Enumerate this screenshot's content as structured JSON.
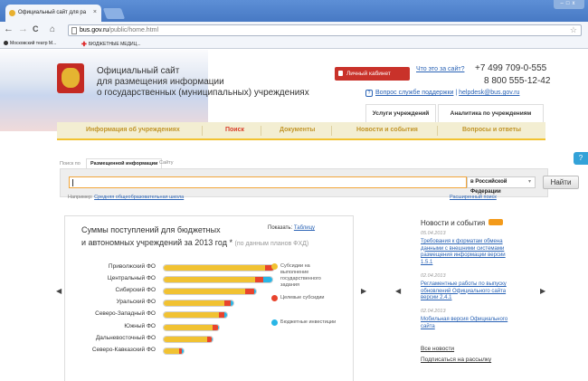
{
  "browser": {
    "tab_title": "Официальный сайт для ра",
    "tab_close": "×",
    "url_domain": "bus.gov.ru",
    "url_path": "/public/home.html",
    "nav": {
      "back": "←",
      "forward": "→",
      "reload": "C",
      "home": "⌂"
    },
    "star": "☆",
    "bookmarks": [
      "Московский театр М...",
      "БЮДЖЕТНЫЕ МЕДИЦ..."
    ],
    "window_buttons": "–□x"
  },
  "header": {
    "site_title_lines": [
      "Официальный сайт",
      "для размещения информации",
      "о государственных (муниципальных) учреждениях"
    ],
    "cabinet_button": "Личный кабинет",
    "what_link": "Что это за сайт?",
    "phone1": "+7 499 709-0-555",
    "phone2": "8 800 555-12-42",
    "support_link": "Вопрос службе поддержки",
    "support_sep": " | ",
    "support_email": "helpdesk@bus.gov.ru",
    "support_icon": "?",
    "subtabs": [
      "Услуги учреждений",
      "Аналитика по учреждениям"
    ]
  },
  "main_nav": {
    "items": [
      "Информация об учреждениях",
      "Поиск",
      "Документы",
      "Новости и события",
      "Вопросы и ответы"
    ],
    "active_index": 1
  },
  "help_button": "?",
  "search": {
    "prefix_label": "Поиск по",
    "tabs": [
      "Размещенной информации",
      "Сайту"
    ],
    "query_value": "",
    "scope_value": "в Российской Федерации",
    "scope_caret": "▾",
    "go_button": "Найти",
    "hint_prefix": "Например:",
    "hint_example": "Средняя общеобразовательная школа",
    "advanced_link": "Расширенный поиск"
  },
  "chart_panel": {
    "title_line1": "Суммы поступлений для бюджетных",
    "title_line2": "и автономных учреждений за 2013 год",
    "title_star": " *",
    "subtitle": "(по данным планов ФХД)",
    "show_label": "Показать:",
    "show_link": "Таблицу",
    "prev_arrow": "◀",
    "next_arrow": "▶"
  },
  "chart_data": {
    "type": "bar",
    "orientation": "horizontal",
    "stacked": true,
    "categories": [
      "Приволжский ФО",
      "Центральный ФО",
      "Сибирский ФО",
      "Уральский ФО",
      "Северо-Западный ФО",
      "Южный ФО",
      "Дальневосточный ФО",
      "Северо-Кавказский ФО"
    ],
    "series": [
      {
        "name": "Субсидии на выполнение государственного задания",
        "color": "#f1c232",
        "values": [
          93,
          84,
          75,
          56,
          51,
          45,
          40,
          14
        ]
      },
      {
        "name": "Целевые субсидии",
        "color": "#e8442d",
        "values": [
          8,
          8,
          8,
          6,
          5,
          5,
          4,
          3
        ]
      },
      {
        "name": "Бюджетные инвестиции",
        "color": "#29b6e6",
        "values": [
          1,
          8,
          2,
          2,
          2,
          1,
          1,
          1
        ]
      }
    ],
    "legend_position": "right",
    "axis_labels_shown": false,
    "grid": false
  },
  "news": {
    "title": "Новости и события",
    "prev_arrow": "◀",
    "next_arrow": "▶",
    "items": [
      {
        "date": "05.04.2013",
        "lines": [
          "Требования к форматам обмена",
          "данными с внешними системами",
          "размещения информации версии",
          "1.5.1"
        ]
      },
      {
        "date": "02.04.2013",
        "lines": [
          "Регламентные работы по выпуску",
          "обновлений Официального сайта",
          "версии 2.4.1"
        ]
      },
      {
        "date": "02.04.2013",
        "lines": [
          "Мобильная версия Официального",
          "сайта"
        ]
      }
    ],
    "all_news": "Все новости",
    "subscribe": "Подписаться на рассылку"
  },
  "colors": {
    "accent_red": "#c9322a",
    "nav_bg": "#f3eed2",
    "nav_underline": "#f2c22f",
    "link": "#2a63b5"
  }
}
